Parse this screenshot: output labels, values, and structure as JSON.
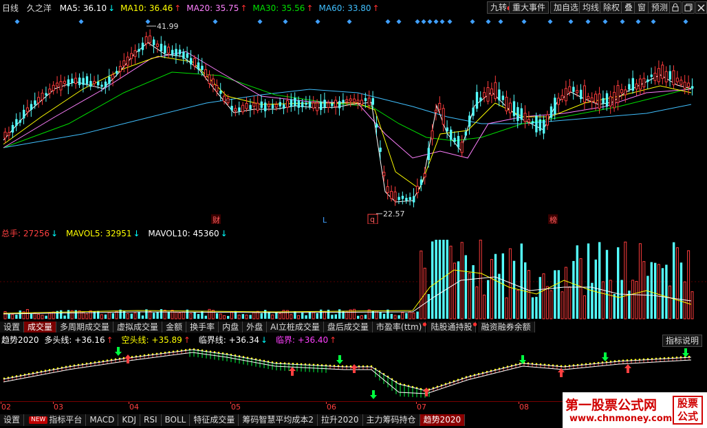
{
  "header": {
    "period": "日线",
    "stock_name": "久之洋",
    "ma": [
      {
        "label": "MA5: 36.10",
        "arrow": "↓",
        "color": "#ffffff",
        "arrow_color": "#00ffff"
      },
      {
        "label": "MA10: 36.46",
        "arrow": "↑",
        "color": "#ffff00",
        "arrow_color": "#ff3030"
      },
      {
        "label": "MA20: 35.75",
        "arrow": "↑",
        "color": "#ff80ff",
        "arrow_color": "#ff3030"
      },
      {
        "label": "MA30: 35.56",
        "arrow": "↑",
        "color": "#00e000",
        "arrow_color": "#ff3030"
      },
      {
        "label": "MA60: 33.80",
        "arrow": "↑",
        "color": "#40c0ff",
        "arrow_color": "#ff3030"
      }
    ]
  },
  "toolbar": {
    "jiuzhuan": "九转",
    "major_events": "重大事件",
    "add_watch": "加自选",
    "trend_line": "均线",
    "exclude_rights": "除权",
    "overlay": "叠",
    "window": "窗",
    "forecast": "预测"
  },
  "price_chart": {
    "high_label": "41.99",
    "low_label": "22.57",
    "markers": {
      "cai": "财",
      "l": "L",
      "q": "q",
      "bang": "榜"
    }
  },
  "volume": {
    "total_label": "总手: 27256",
    "mavol5": "MAVOL5: 32951",
    "mavol10": "MAVOL10: 45360"
  },
  "indicator_tabs": [
    "设置",
    "成交量",
    "多周期成交量",
    "虚拟成交量",
    "金额",
    "换手率",
    "内盘",
    "外盘",
    "AI立桩成交量",
    "盘后成交量",
    "市盈率(ttm)",
    "陆股通持股",
    "融资融券余额"
  ],
  "indicator_tabs_active": 1,
  "trend": {
    "name": "趋势2020",
    "long_line": "多头线: +36.16",
    "short_line": "空头线: +35.89",
    "critical_line": "临界线: +36.34",
    "critical": "临界: +36.40",
    "explain_button": "指标说明"
  },
  "x_axis": [
    "02",
    "03",
    "04",
    "05",
    "06",
    "07",
    "08"
  ],
  "bottom_tabs": [
    "设置",
    "指标平台",
    "MACD",
    "KDJ",
    "RSI",
    "BOLL",
    "特征成交量",
    "筹码智慧平均成本2",
    "拉升2020",
    "主力筹码持仓",
    "趋势2020"
  ],
  "bottom_tabs_new": "NEW",
  "bottom_tabs_active": 10,
  "watermark": {
    "title": "第一股票公式网",
    "url": "www.chnmoney.com",
    "seal_line1": "股票",
    "seal_line2": "公式"
  },
  "colors": {
    "up": "#ff3c3c",
    "down": "#54ffff",
    "ma5": "#ffffff",
    "ma10": "#ffff00",
    "ma20": "#ff80ff",
    "ma30": "#00e000",
    "ma60": "#40c0ff",
    "background": "#000000"
  }
}
